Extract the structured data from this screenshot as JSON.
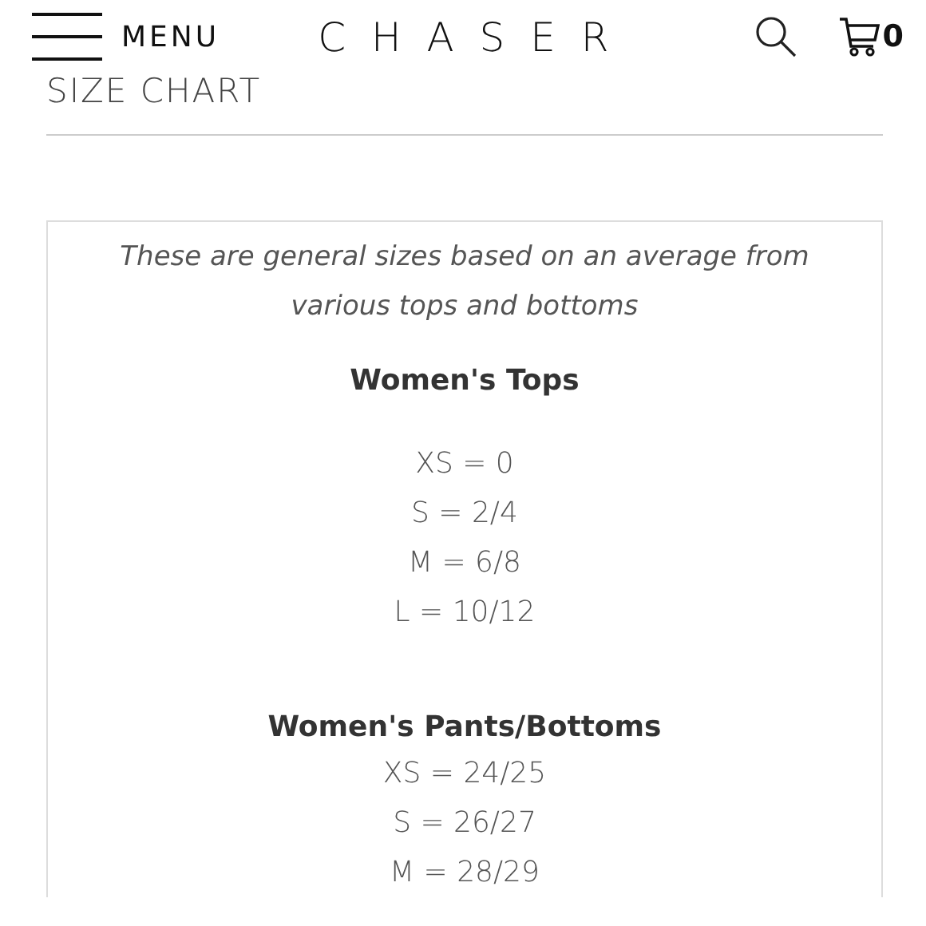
{
  "header": {
    "menu_label": "MENU",
    "logo": "C H A S E R",
    "cart_count": "0"
  },
  "page_title": "SIZE CHART",
  "intro": "These are general sizes based on an average from various tops and bottoms",
  "sections": [
    {
      "heading": "Women's Tops",
      "rows": [
        "XS = 0",
        "S = 2/4",
        "M = 6/8",
        "L = 10/12"
      ]
    },
    {
      "heading": "Women's Pants/Bottoms",
      "rows": [
        "XS = 24/25",
        "S = 26/27",
        "M = 28/29"
      ]
    }
  ]
}
